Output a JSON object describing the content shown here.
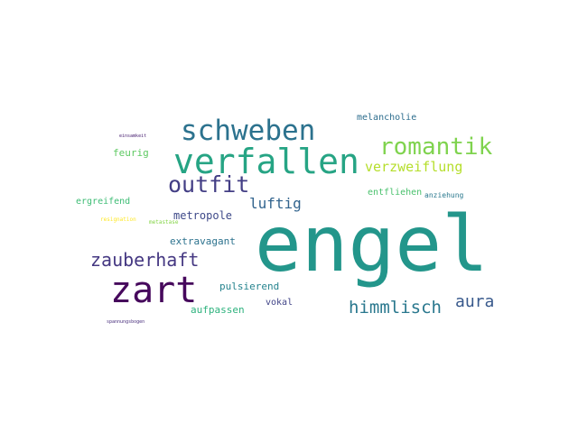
{
  "words": [
    {
      "text": "engel",
      "color": "#23968b"
    },
    {
      "text": "verfallen",
      "color": "#26a484"
    },
    {
      "text": "zart",
      "color": "#46085c"
    },
    {
      "text": "schweben",
      "color": "#2c728e"
    },
    {
      "text": "romantik",
      "color": "#7fd34e"
    },
    {
      "text": "outfit",
      "color": "#433e85"
    },
    {
      "text": "zauberhaft",
      "color": "#453882"
    },
    {
      "text": "himmlisch",
      "color": "#2a788e"
    },
    {
      "text": "aura",
      "color": "#38598c"
    },
    {
      "text": "luftig",
      "color": "#32648e"
    },
    {
      "text": "verzweiflung",
      "color": "#b5de2b"
    },
    {
      "text": "metropole",
      "color": "#3e4989"
    },
    {
      "text": "extravagant",
      "color": "#2c728e"
    },
    {
      "text": "pulsierend",
      "color": "#25838e"
    },
    {
      "text": "aufpassen",
      "color": "#2db27d"
    },
    {
      "text": "vokal",
      "color": "#414487"
    },
    {
      "text": "feurig",
      "color": "#5ec962"
    },
    {
      "text": "ergreifend",
      "color": "#3dbc74"
    },
    {
      "text": "entfliehen",
      "color": "#4ac16d"
    },
    {
      "text": "anziehung",
      "color": "#2a788e"
    },
    {
      "text": "melancholie",
      "color": "#2e6e8e"
    },
    {
      "text": "resignation",
      "color": "#fde725"
    },
    {
      "text": "metastase",
      "color": "#86d549"
    },
    {
      "text": "einsamkeit",
      "color": "#482071"
    },
    {
      "text": "spannungsbogen",
      "color": "#472d7b"
    }
  ]
}
